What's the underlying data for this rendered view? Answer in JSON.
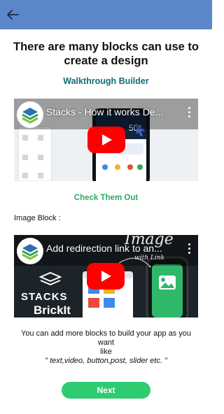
{
  "header": {
    "back_icon": "arrow-left-icon",
    "bar_color": "#5b86c9"
  },
  "intro": {
    "heading": "There are many blocks can use to create a design",
    "builder_link": "Walkthrough Builder"
  },
  "video_one": {
    "title": "Stacks - How it works De...",
    "menu_icon": "more-vert-icon",
    "play_icon": "play-icon"
  },
  "check_out": "Check Them Out",
  "image_block_label": "Image Block :",
  "video_two": {
    "title": "Add redirection link to an...",
    "menu_icon": "more-vert-icon",
    "play_icon": "play-icon",
    "brand_top": "STACKS",
    "brand_bottom": "BrickIt",
    "handwriting": "Image",
    "handwriting_sub": "with Link"
  },
  "description": {
    "line1": "You can add more blocks to build your app as you want",
    "line2": "like",
    "examples": "\" text,video, button,post, slider etc. \""
  },
  "next_button": "Next",
  "colors": {
    "accent_green": "#2ecc71",
    "link_teal": "#0f6e78",
    "youtube_red": "#ff0000"
  }
}
